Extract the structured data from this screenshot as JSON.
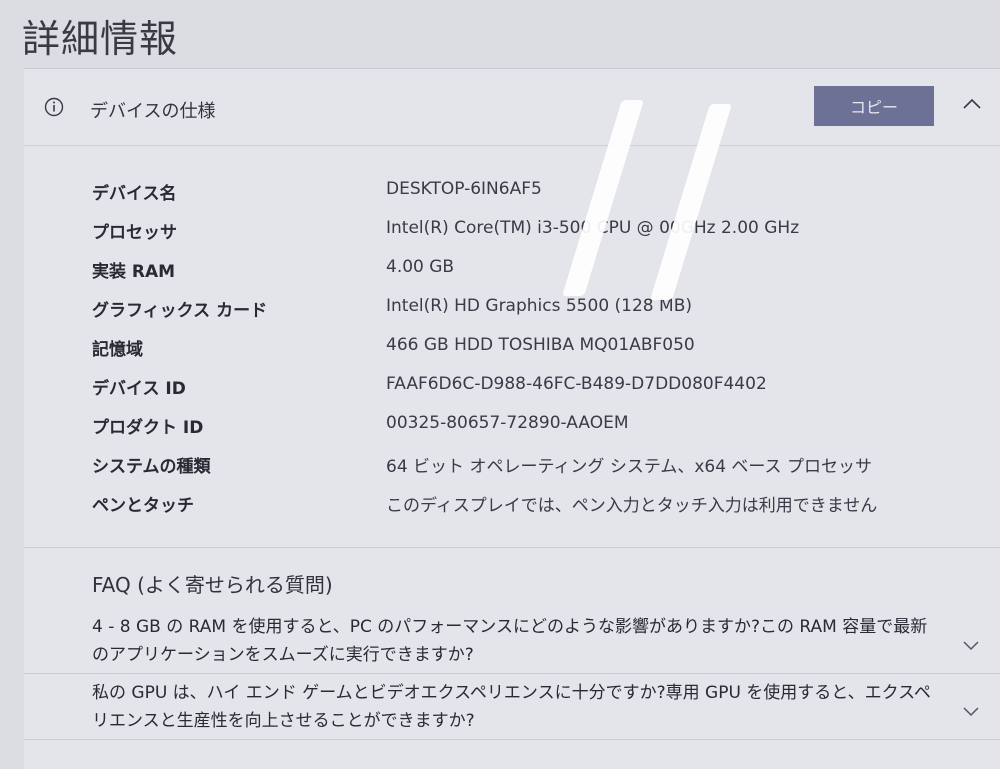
{
  "page": {
    "title": "詳細情報"
  },
  "device_specs": {
    "header_label": "デバイスの仕様",
    "copy_label": "コピー",
    "rows": [
      {
        "label": "デバイス名",
        "value": "DESKTOP-6IN6AF5"
      },
      {
        "label": "プロセッサ",
        "value": "Intel(R) Core(TM) i3-500  CPU @  00GHz   2.00 GHz"
      },
      {
        "label": "実装 RAM",
        "value": "4.00 GB"
      },
      {
        "label": "グラフィックス カード",
        "value": "Intel(R) HD Graphics 5500 (128 MB)"
      },
      {
        "label": "記憶域",
        "value": "466 GB HDD TOSHIBA MQ01ABF050"
      },
      {
        "label": "デバイス ID",
        "value": "FAAF6D6C-D988-46FC-B489-D7DD080F4402"
      },
      {
        "label": "プロダクト ID",
        "value": "00325-80657-72890-AAOEM"
      },
      {
        "label": "システムの種類",
        "value": "64 ビット オペレーティング システム、x64 ベース プロセッサ"
      },
      {
        "label": "ペンとタッチ",
        "value": "このディスプレイでは、ペン入力とタッチ入力は利用できません"
      }
    ]
  },
  "faq": {
    "title": "FAQ (よく寄せられる質問)",
    "items": [
      {
        "text": "4 - 8 GB の RAM を使用すると、PC のパフォーマンスにどのような影響がありますか?この RAM 容量で最新のアプリケーションをスムーズに実行できますか?"
      },
      {
        "text": "私の GPU は、ハイ エンド ゲームとビデオエクスペリエンスに十分ですか?専用 GPU を使用すると、エクスペリエンスと生産性を向上させることができますか?"
      }
    ]
  },
  "icons": {
    "info": "info-circle-icon",
    "collapse": "chevron-up-icon",
    "expand": "chevron-down-icon"
  },
  "colors": {
    "accent_button": "#6e7196",
    "background": "#dcdde2",
    "card": "#e4e5ea"
  }
}
